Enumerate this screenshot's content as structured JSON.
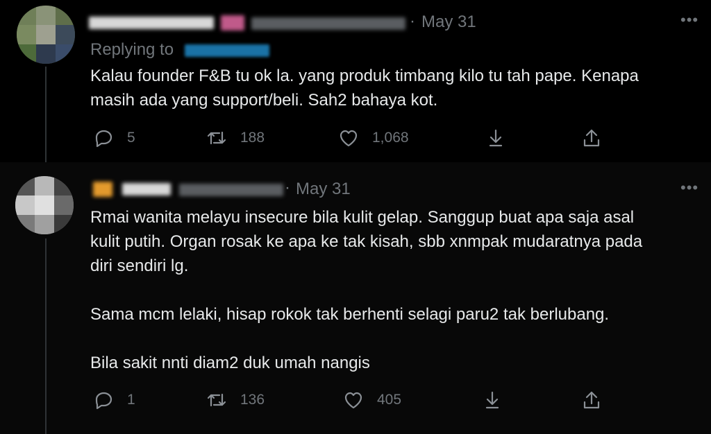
{
  "tweets": [
    {
      "date": "May 31",
      "replying_label": "Replying to",
      "text_lines": [
        "Kalau founder F&B tu ok la. yang produk timbang kilo tu tah pape. Kenapa",
        "masih ada yang support/beli. Sah2 bahaya kot."
      ],
      "actions": {
        "replies": "5",
        "retweets": "188",
        "likes": "1,068"
      }
    },
    {
      "date": "May 31",
      "paragraphs": [
        "Rmai wanita melayu insecure bila kulit gelap. Sanggup buat apa saja asal",
        "kulit putih. Organ rosak ke apa ke tak kisah, sbb xnmpak mudaratnya pada",
        "diri sendiri lg.",
        "",
        "Sama mcm lelaki, hisap rokok tak berhenti selagi paru2 tak berlubang.",
        "",
        "Bila sakit nnti diam2 duk umah nangis"
      ],
      "actions": {
        "replies": "1",
        "retweets": "136",
        "likes": "405"
      }
    }
  ],
  "icons": {
    "reply": "speech-bubble-icon",
    "retweet": "retweet-icon",
    "like": "heart-icon",
    "download": "download-arrow-icon",
    "share": "share-icon",
    "more": "more-dots-icon"
  },
  "colors": {
    "background": "#000000",
    "text": "#e7e9ea",
    "muted": "#71767b",
    "mention": "#1d9bf0"
  }
}
